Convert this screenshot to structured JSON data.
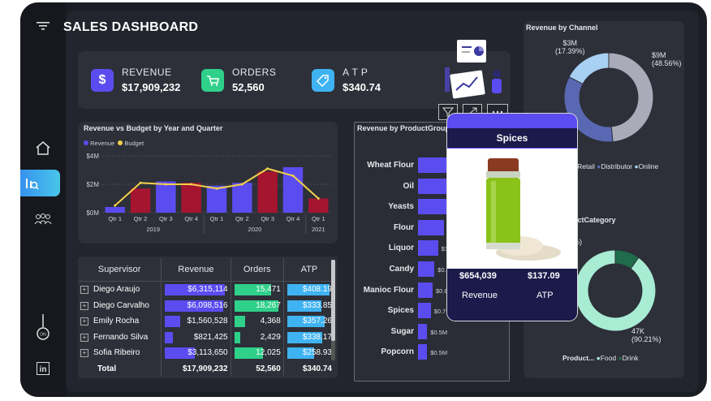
{
  "dashboard": {
    "title": "SALES DASHBOARD"
  },
  "kpis": [
    {
      "label": "REVENUE",
      "value": "$17,909,232",
      "color": "#5b4cf0",
      "icon": "dollar-icon"
    },
    {
      "label": "ORDERS",
      "value": "52,560",
      "color": "#2fd08a",
      "icon": "cart-icon"
    },
    {
      "label": "A T P",
      "value": "$340.74",
      "color": "#3fb3f2",
      "icon": "tag-icon"
    }
  ],
  "rvb": {
    "title": "Revenue vs Budget by Year and Quarter",
    "legend": [
      "Revenue",
      "Budget"
    ],
    "y_ticks": [
      "$4M",
      "$2M",
      "$0M"
    ]
  },
  "chart_data": [
    {
      "type": "bar",
      "title": "Revenue vs Budget by Year and Quarter",
      "categories": [
        "2019 Qtr 1",
        "2019 Qtr 2",
        "2019 Qtr 3",
        "2019 Qtr 4",
        "2020 Qtr 1",
        "2020 Qtr 2",
        "2020 Qtr 3",
        "2020 Qtr 4",
        "2021 Qtr 1"
      ],
      "x_tick_labels": [
        "Qtr 1",
        "Qtr 2",
        "Qtr 3",
        "Qtr 4",
        "Qtr 1",
        "Qtr 2",
        "Qtr 3",
        "Qtr 4",
        "Qtr 1"
      ],
      "year_labels": [
        "2019",
        "2020",
        "2021"
      ],
      "series": [
        {
          "name": "Revenue",
          "values": [
            0.4,
            1.7,
            2.2,
            2.1,
            1.9,
            2.1,
            2.9,
            3.2,
            1.0
          ],
          "colors": [
            "#5b4cf0",
            "#a51530",
            "#5b4cf0",
            "#a51530",
            "#5b4cf0",
            "#5b4cf0",
            "#a51530",
            "#5b4cf0",
            "#a51530"
          ]
        },
        {
          "name": "Budget",
          "values": [
            0.5,
            2.1,
            2.0,
            2.0,
            1.7,
            2.0,
            3.1,
            2.6,
            1.0
          ],
          "color": "#f2d04a"
        }
      ],
      "ylim": [
        0,
        4
      ]
    },
    {
      "type": "bar",
      "title": "Revenue by ProductGroup",
      "categories": [
        "Wheat Flour",
        "Oil",
        "Yeasts",
        "Flour",
        "Liquor",
        "Candy",
        "Manioc Flour",
        "Spices",
        "Sugar",
        "Popcorn"
      ],
      "data_labels": [
        "",
        "",
        "",
        "",
        "$1.",
        "$0.9",
        "$0.8",
        "$0.7",
        "$0.5M",
        "$0.5M"
      ],
      "values": [
        2.0,
        1.9,
        1.8,
        1.4,
        1.1,
        0.9,
        0.8,
        0.7,
        0.5,
        0.5
      ],
      "color": "#5b4cf0"
    },
    {
      "type": "pie",
      "title": "Revenue by Channel",
      "labels": [
        "Retail",
        "Distributor",
        "Online"
      ],
      "values": [
        48.56,
        34.05,
        17.39
      ],
      "data_labels": [
        "$9M\n(48.56%)",
        "",
        "$3M\n(17.39%)"
      ],
      "colors": [
        "#a9acb8",
        "#5a68b4",
        "#a8d0f2"
      ]
    },
    {
      "type": "pie",
      "title": "Revenue by ProductCategory",
      "labels": [
        "Food",
        "Drink"
      ],
      "values": [
        90.21,
        9.79
      ],
      "data_labels": [
        "47K\n(90.21%)",
        "%)"
      ],
      "colors": [
        "#a8ecd4",
        "#1f6b4a"
      ]
    }
  ],
  "table": {
    "headers": [
      "Supervisor",
      "Revenue",
      "Orders",
      "ATP"
    ],
    "rows": [
      {
        "name": "Diego Araujo",
        "revenue": "$6,315,114",
        "orders": "15,471",
        "atp": "$408.19",
        "rf": 1.0,
        "of": 0.85,
        "af": 1.0
      },
      {
        "name": "Diego Carvalho",
        "revenue": "$6,098,516",
        "orders": "18,267",
        "atp": "$333.85",
        "rf": 0.97,
        "of": 1.0,
        "af": 0.82
      },
      {
        "name": "Emily Rocha",
        "revenue": "$1,560,528",
        "orders": "4,368",
        "atp": "$357.26",
        "rf": 0.25,
        "of": 0.24,
        "af": 0.88
      },
      {
        "name": "Fernando Silva",
        "revenue": "$821,425",
        "orders": "2,429",
        "atp": "$338.17",
        "rf": 0.13,
        "of": 0.13,
        "af": 0.83
      },
      {
        "name": "Sofia Ribeiro",
        "revenue": "$3,113,650",
        "orders": "12,025",
        "atp": "$258.93",
        "rf": 0.49,
        "of": 0.66,
        "af": 0.63
      }
    ],
    "total": {
      "label": "Total",
      "revenue": "$17,909,232",
      "orders": "52,560",
      "atp": "$340.74"
    }
  },
  "product_group": {
    "title": "Revenue by ProductGroup"
  },
  "channel": {
    "title": "Revenue by Channel",
    "legend": [
      "Retail",
      "Distributor",
      "Online"
    ],
    "lbl_online_val": "$3M",
    "lbl_online_pct": "(17.39%)",
    "lbl_retail_val": "$9M",
    "lbl_retail_pct": "(48.56%)"
  },
  "category": {
    "title_partial": "uctCategory",
    "legend_title": "Product...",
    "legend": [
      "Food",
      "Drink"
    ],
    "lbl_food_val": "47K",
    "lbl_food_pct": "(90.21%)",
    "lbl_drink_partial": "%)"
  },
  "tooltip": {
    "title": "Spices",
    "revenue": "$654,039",
    "atp": "$137.09",
    "revenue_label": "Revenue",
    "atp_label": "ATP"
  }
}
